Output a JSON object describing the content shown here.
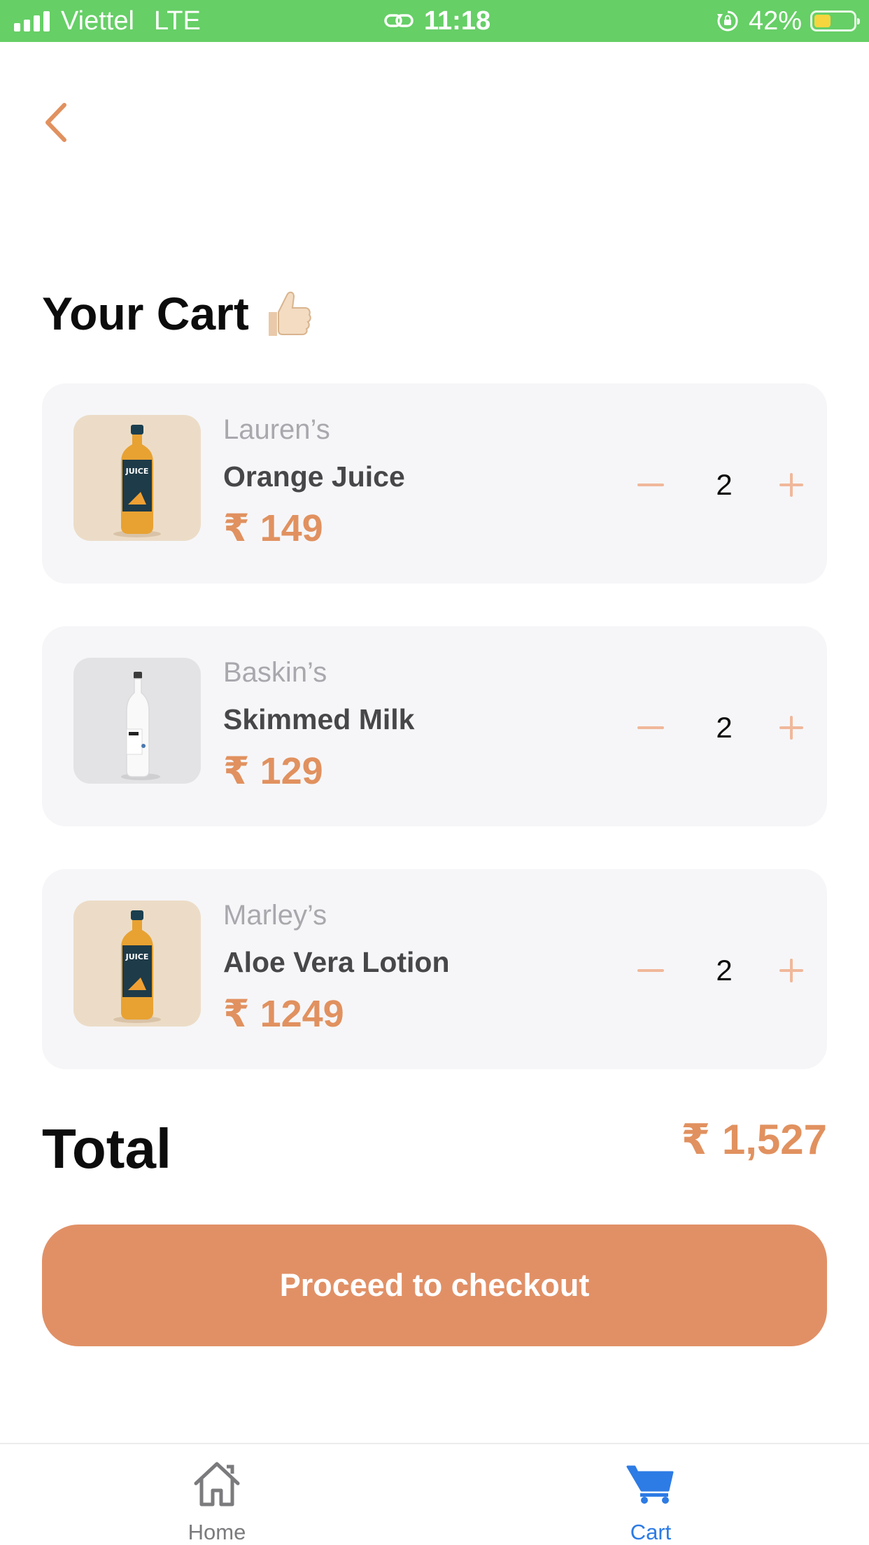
{
  "status_bar": {
    "carrier": "Viettel",
    "network": "LTE",
    "time": "11:18",
    "battery": "42%",
    "battery_level": 0.42,
    "battery_color": "#f6d53f"
  },
  "header": {
    "back_icon": "chevron-left-icon"
  },
  "page": {
    "title": "Your Cart",
    "title_icon": "thumbs-up-icon"
  },
  "cart": {
    "items": [
      {
        "brand": "Lauren’s",
        "name": "Orange Juice",
        "price": "₹ 149",
        "quantity": "2",
        "image_icon": "juice-bottle-image"
      },
      {
        "brand": "Baskin’s",
        "name": "Skimmed Milk",
        "price": "₹ 129",
        "quantity": "2",
        "image_icon": "milk-bottle-image"
      },
      {
        "brand": "Marley’s",
        "name": "Aloe Vera Lotion",
        "price": "₹ 1249",
        "quantity": "2",
        "image_icon": "juice-bottle-image"
      }
    ]
  },
  "summary": {
    "total_label": "Total",
    "total_value": "₹ 1,527"
  },
  "checkout": {
    "label": "Proceed to checkout"
  },
  "bottom_nav": {
    "items": [
      {
        "label": "Home",
        "icon": "home-icon",
        "active": false
      },
      {
        "label": "Cart",
        "icon": "cart-icon",
        "active": true
      }
    ]
  },
  "colors": {
    "accent": "#e19066",
    "price": "#e1915f",
    "status_bar": "#66cf66",
    "active_nav": "#2d7be5",
    "card_background": "#f6f6f8"
  }
}
